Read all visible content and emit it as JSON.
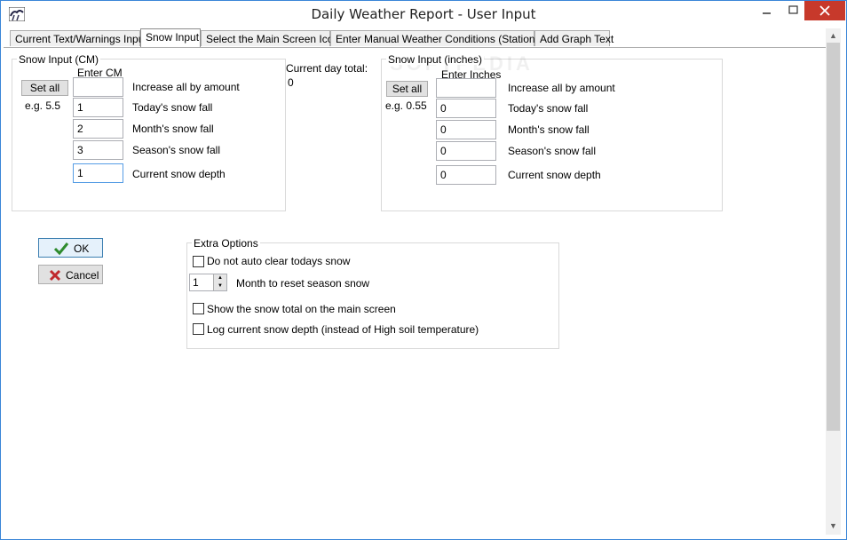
{
  "window": {
    "title": "Daily Weather Report - User Input"
  },
  "tabs": [
    {
      "label": "Current Text/Warnings Input"
    },
    {
      "label": "Snow Input"
    },
    {
      "label": "Select the Main Screen Icon"
    },
    {
      "label": "Enter Manual Weather Conditions (Stationless)"
    },
    {
      "label": "Add Graph Text"
    }
  ],
  "snow_cm": {
    "legend": "Snow Input (CM)",
    "enter_label": "Enter CM",
    "set_all_label": "Set all",
    "example": "e.g. 5.5",
    "rows": [
      {
        "label": "Increase all by amount",
        "value": ""
      },
      {
        "label": "Today's snow fall",
        "value": "1"
      },
      {
        "label": "Month's snow fall",
        "value": "2"
      },
      {
        "label": "Season's snow fall",
        "value": "3"
      },
      {
        "label": "Current snow depth",
        "value": "1"
      }
    ]
  },
  "current_day": {
    "label": "Current day total:",
    "value": "0"
  },
  "snow_in": {
    "legend": "Snow Input (inches)",
    "enter_label": "Enter Inches",
    "set_all_label": "Set all",
    "example": "e.g. 0.55",
    "rows": [
      {
        "label": "Increase all by amount",
        "value": ""
      },
      {
        "label": "Today's snow fall",
        "value": "0"
      },
      {
        "label": "Month's snow fall",
        "value": "0"
      },
      {
        "label": "Season's snow fall",
        "value": "0"
      },
      {
        "label": "Current snow depth",
        "value": "0"
      }
    ]
  },
  "buttons": {
    "ok": "OK",
    "cancel": "Cancel"
  },
  "extra": {
    "legend": "Extra Options",
    "no_auto_clear": "Do not auto clear todays snow",
    "month_value": "1",
    "month_label": "Month to reset season snow",
    "show_total": "Show the snow total on the main screen",
    "log_depth": "Log current snow depth (instead of High soil temperature)"
  },
  "colors": {
    "close_button": "#c7392b",
    "ok_check": "#2e8b2e",
    "cancel_x": "#c0282d"
  }
}
